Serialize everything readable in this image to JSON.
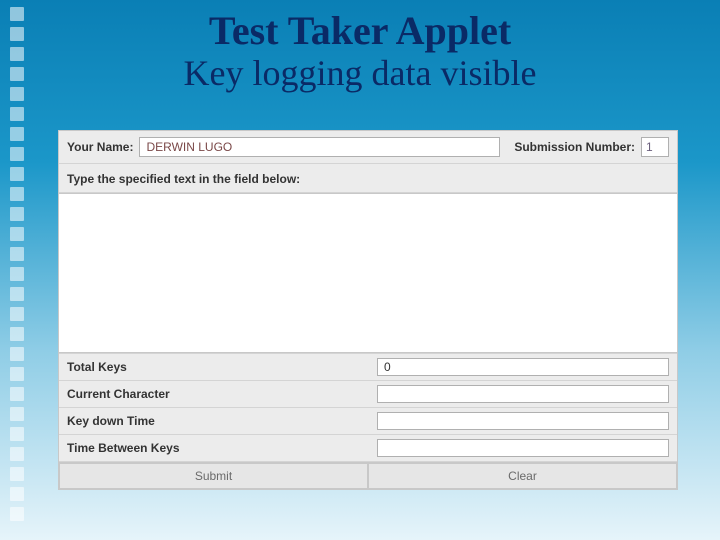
{
  "slide": {
    "title": "Test Taker Applet",
    "subtitle": "Key logging data visible"
  },
  "form": {
    "name_label": "Your Name:",
    "name_value": "DERWIN LUGO",
    "submission_label": "Submission Number:",
    "submission_value": "1",
    "instruction": "Type the specified text in the field below:",
    "text_value": ""
  },
  "stats": {
    "total_keys_label": "Total Keys",
    "total_keys_value": "0",
    "current_char_label": "Current Character",
    "current_char_value": "",
    "key_down_label": "Key down Time",
    "key_down_value": "",
    "between_keys_label": "Time Between Keys",
    "between_keys_value": ""
  },
  "buttons": {
    "submit": "Submit",
    "clear": "Clear"
  }
}
